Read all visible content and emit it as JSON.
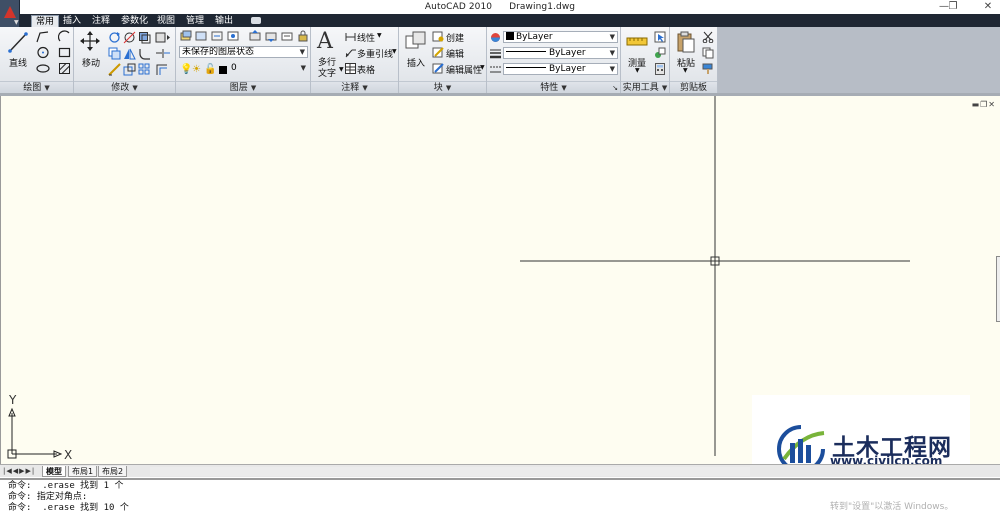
{
  "window": {
    "app_title": "AutoCAD 2010",
    "doc_title": "Drawing1.dwg",
    "minimize": "—",
    "restore": "❐",
    "close": "✕"
  },
  "tabs": [
    "常用",
    "插入",
    "注释",
    "参数化",
    "视图",
    "管理",
    "输出"
  ],
  "ribbon": {
    "draw": {
      "title": "绘图",
      "line_label": "直线"
    },
    "modify": {
      "title": "修改",
      "move_label": "移动"
    },
    "layers": {
      "title": "图层",
      "layer_state": "未保存的图层状态",
      "current_layer": "0"
    },
    "annotation": {
      "title": "注释",
      "mtext_label_1": "多行",
      "mtext_label_2": "文字",
      "linear_label": "线性",
      "mleader_label": "多重引线",
      "table_label": "表格"
    },
    "block": {
      "title": "块",
      "insert_label": "插入",
      "create_label": "创建",
      "edit_label": "编辑",
      "edit_attr_label": "编辑属性"
    },
    "properties": {
      "title": "特性",
      "color": "ByLayer",
      "linetype": "ByLayer",
      "lineweight": "ByLayer"
    },
    "utilities": {
      "title": "实用工具",
      "measure_label": "测量"
    },
    "clipboard": {
      "title": "剪贴板",
      "paste_label": "粘贴"
    }
  },
  "ucs": {
    "x_label": "X",
    "y_label": "Y"
  },
  "layout_tabs": [
    "模型",
    "布局1",
    "布局2"
  ],
  "command_history": [
    "命令:  .erase 找到 1 个",
    "命令: 指定对角点:",
    "命令:  .erase 找到 10 个"
  ],
  "activation_watermark": "转到\"设置\"以激活 Windows。",
  "site_logo": {
    "name": "土木工程网",
    "url": "www.civilcn.com"
  },
  "colors": {
    "canvas": "#fefdf1",
    "tabbar": "#1f2733",
    "accent_red": "#d3342b"
  }
}
